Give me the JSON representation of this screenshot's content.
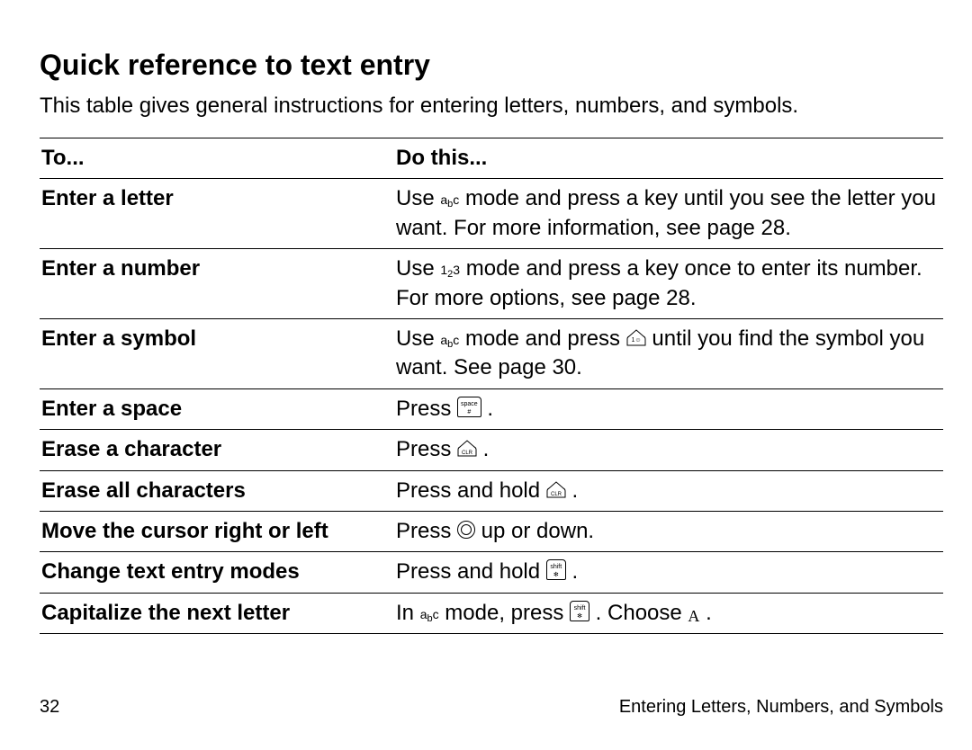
{
  "page_number": "32",
  "section_footer": "Entering Letters, Numbers, and Symbols",
  "heading": "Quick reference to text entry",
  "intro": "This table gives general instructions for entering letters, numbers, and symbols.",
  "table": {
    "headers": {
      "left": "To...",
      "right": "Do this..."
    },
    "rows": [
      {
        "key": "Enter a letter",
        "val_parts": [
          "Use ",
          {
            "icon": "abc"
          },
          " mode and press a key until you see the letter you want. For more information, see page 28."
        ]
      },
      {
        "key": "Enter a number",
        "val_parts": [
          "Use ",
          {
            "icon": "123"
          },
          " mode and press a key once to enter its number. For more options, see page 28."
        ]
      },
      {
        "key": "Enter a symbol",
        "val_parts": [
          "Use ",
          {
            "icon": "abc"
          },
          " mode and press ",
          {
            "icon": "key-1"
          },
          " until you find the symbol you want. See page 30."
        ]
      },
      {
        "key": "Enter a space",
        "val_parts": [
          "Press ",
          {
            "icon": "key-space"
          },
          " ."
        ]
      },
      {
        "key": "Erase a character",
        "val_parts": [
          "Press ",
          {
            "icon": "key-clr"
          },
          " ."
        ]
      },
      {
        "key": "Erase all characters",
        "val_parts": [
          "Press and hold ",
          {
            "icon": "key-clr"
          },
          " ."
        ]
      },
      {
        "key": "Move the cursor right or left",
        "val_parts": [
          "Press ",
          {
            "icon": "key-nav"
          },
          " up or down."
        ]
      },
      {
        "key": "Change text entry modes",
        "val_parts": [
          "Press and hold ",
          {
            "icon": "key-mode"
          },
          " ."
        ]
      },
      {
        "key": "Capitalize the next letter",
        "val_parts": [
          "In ",
          {
            "icon": "abc"
          },
          " mode, press ",
          {
            "icon": "key-mode"
          },
          " . Choose  ",
          {
            "icon": "capA"
          },
          " ."
        ]
      }
    ]
  }
}
